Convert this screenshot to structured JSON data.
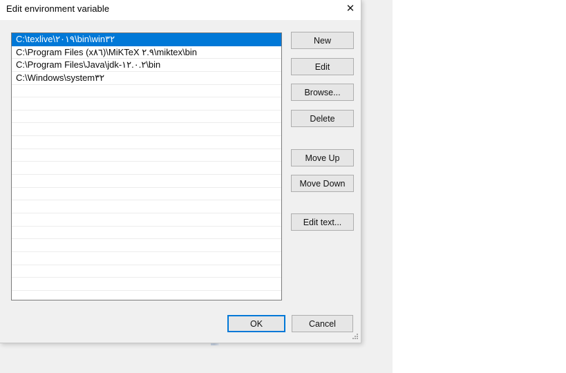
{
  "background_window": {
    "ok_label": "OK",
    "cancel_label": "Cancel",
    "scroll_up_glyph": "⌃",
    "scroll_down_glyph": "⌄"
  },
  "dialog": {
    "title": "Edit environment variable",
    "close_glyph": "✕",
    "path_entries": [
      {
        "value": "C:\\texlive\\٢٠١٩\\bin\\win٣٢",
        "selected": true
      },
      {
        "value": "C:\\Program Files (x٨٦)\\MiKTeX ٢.٩\\miktex\\bin",
        "selected": false
      },
      {
        "value": "C:\\Program Files\\Java\\jdk-١٢.٠.٢\\bin",
        "selected": false
      },
      {
        "value": "C:\\Windows\\system٣٢",
        "selected": false
      }
    ],
    "empty_row_count": 16,
    "side_buttons": {
      "new": "New",
      "edit": "Edit",
      "browse": "Browse...",
      "delete": "Delete",
      "move_up": "Move Up",
      "move_down": "Move Down",
      "edit_text": "Edit text..."
    },
    "ok_label": "OK",
    "cancel_label": "Cancel",
    "accent_color": "#0078d7",
    "selection_color": "#0078d7",
    "dialog_bg_color": "#f0f0f0",
    "listbox_bg_color": "#ffffff"
  }
}
